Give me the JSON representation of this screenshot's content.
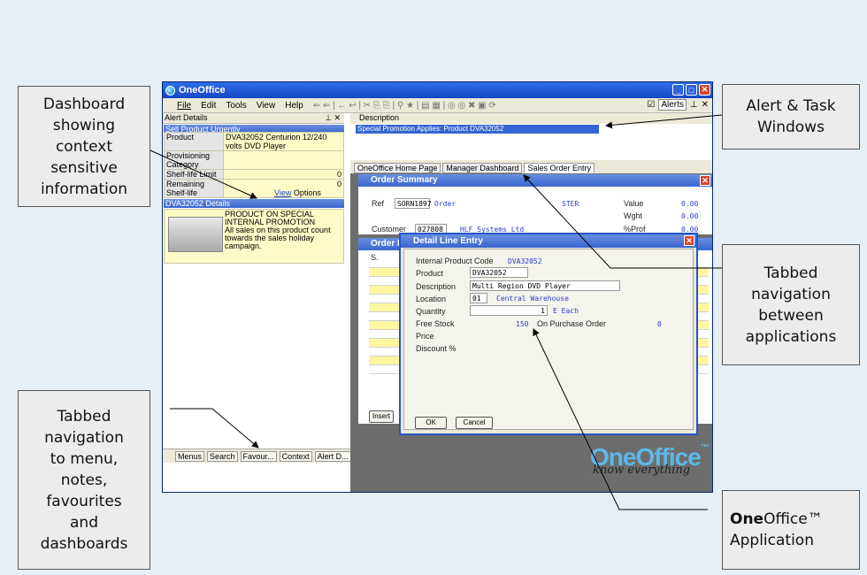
{
  "callouts": {
    "dashboard": "Dashboard\nshowing\ncontext\nsensitive\ninformation",
    "alerts": "Alert & Task\nWindows",
    "tabbed_apps": "Tabbed\nnavigation\nbetween\napplications",
    "tabbed_menu": "Tabbed\nnavigation\nto menu,\nnotes,\nfavourites\nand\ndashboards",
    "brand_bold": "One",
    "brand_rest": "Office™\nApplication"
  },
  "window": {
    "title": "OneOffice",
    "menu": [
      "File",
      "Edit",
      "Tools",
      "View",
      "Help"
    ],
    "alerts_label": "Alerts"
  },
  "left": {
    "header": "Alert Details",
    "panel1_title": "Sell Product Urgently",
    "fields": [
      {
        "k": "Product",
        "v1": "DVA32052",
        "v2": "Centurion 12/240 volts DVD Player"
      },
      {
        "k": "Provisioning Category",
        "v1": "",
        "v2": ""
      },
      {
        "k": "Shelf-life Limit",
        "v1": "",
        "v2": "0"
      },
      {
        "k": "Remaining Shelf-life",
        "v1": "",
        "v2": "0"
      }
    ],
    "view": "View",
    "options": "Options",
    "panel2_title": "DVA32052 Details",
    "promo_text": "PRODUCT ON SPECIAL INTERNAL PROMOTION\nAll sales on this product count towards the sales holiday campaign.",
    "tabs": [
      "Menus",
      "Search",
      "Favour...",
      "Context",
      "Alert D..."
    ]
  },
  "right": {
    "desc_header": "Description",
    "promo_row": "Special Promotion Applies: Product DVA32052",
    "tabs": [
      "OneOffice Home Page",
      "Manager Dashboard",
      "Sales Order Entry"
    ]
  },
  "order_summary": {
    "title": "Order Summary",
    "ref_label": "Ref",
    "ref_value": "SORN1897",
    "ref_type": "Order",
    "ster": "STER",
    "customer_label": "Customer",
    "customer_code": "027808",
    "customer_name": "HLF Systems Ltd",
    "value_label": "Value",
    "value": "0.00",
    "wght_label": "Wght",
    "wght": "0.00",
    "prof_label": "%Prof",
    "prof": "0.00"
  },
  "order_lines": {
    "title": "Order L",
    "col": "S.",
    "insert": "Insert"
  },
  "dialog": {
    "title": "Detail Line Entry",
    "fields": {
      "internal_code_label": "Internal Product Code",
      "internal_code": "DVA32052",
      "product_label": "Product",
      "product": "DVA32052",
      "description_label": "Description",
      "description": "Multi Region DVD Player",
      "location_label": "Location",
      "location_code": "01",
      "location_name": "Central Warehouse",
      "quantity_label": "Quantity",
      "quantity": "1",
      "unit": "E  Each",
      "free_stock_label": "Free Stock",
      "free_stock": "150",
      "on_order_label": "On Purchase Order",
      "on_order": "0",
      "price_label": "Price",
      "discount_label": "Discount %"
    },
    "ok": "OK",
    "cancel": "Cancel"
  },
  "branding": {
    "logo": "OneOffice",
    "tm": "™",
    "tagline": "know everything"
  },
  "colors": {
    "title_blue": "#1546c7",
    "accent_cyan": "#5db8e8",
    "yellow_cell": "#fffbc8"
  }
}
